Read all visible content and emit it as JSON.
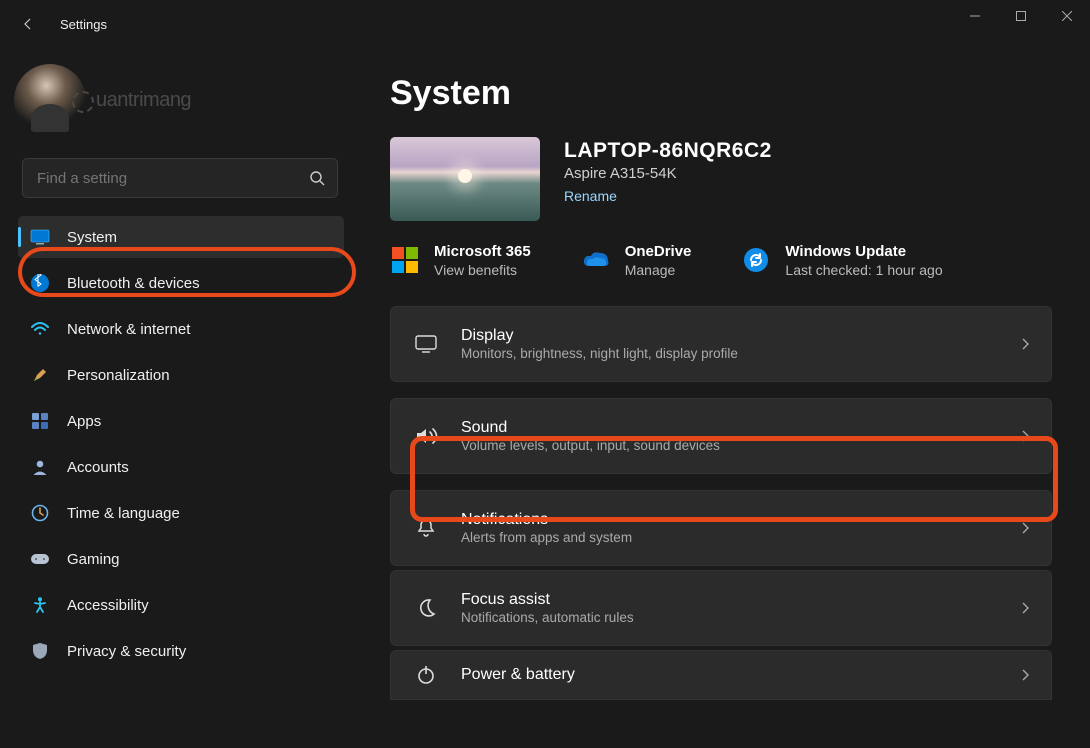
{
  "app_title": "Settings",
  "profile": {
    "watermark": "uantrimang"
  },
  "search": {
    "placeholder": "Find a setting"
  },
  "nav": [
    {
      "label": "System"
    },
    {
      "label": "Bluetooth & devices"
    },
    {
      "label": "Network & internet"
    },
    {
      "label": "Personalization"
    },
    {
      "label": "Apps"
    },
    {
      "label": "Accounts"
    },
    {
      "label": "Time & language"
    },
    {
      "label": "Gaming"
    },
    {
      "label": "Accessibility"
    },
    {
      "label": "Privacy & security"
    }
  ],
  "main": {
    "heading": "System",
    "device": {
      "name": "LAPTOP-86NQR6C2",
      "model": "Aspire A315-54K",
      "rename": "Rename"
    },
    "quick": {
      "ms365": {
        "title": "Microsoft 365",
        "sub": "View benefits"
      },
      "onedrive": {
        "title": "OneDrive",
        "sub": "Manage"
      },
      "wu": {
        "title": "Windows Update",
        "sub": "Last checked: 1 hour ago"
      }
    },
    "cards": [
      {
        "title": "Display",
        "sub": "Monitors, brightness, night light, display profile"
      },
      {
        "title": "Sound",
        "sub": "Volume levels, output, input, sound devices"
      },
      {
        "title": "Notifications",
        "sub": "Alerts from apps and system"
      },
      {
        "title": "Focus assist",
        "sub": "Notifications, automatic rules"
      },
      {
        "title": "Power & battery",
        "sub": ""
      }
    ]
  }
}
